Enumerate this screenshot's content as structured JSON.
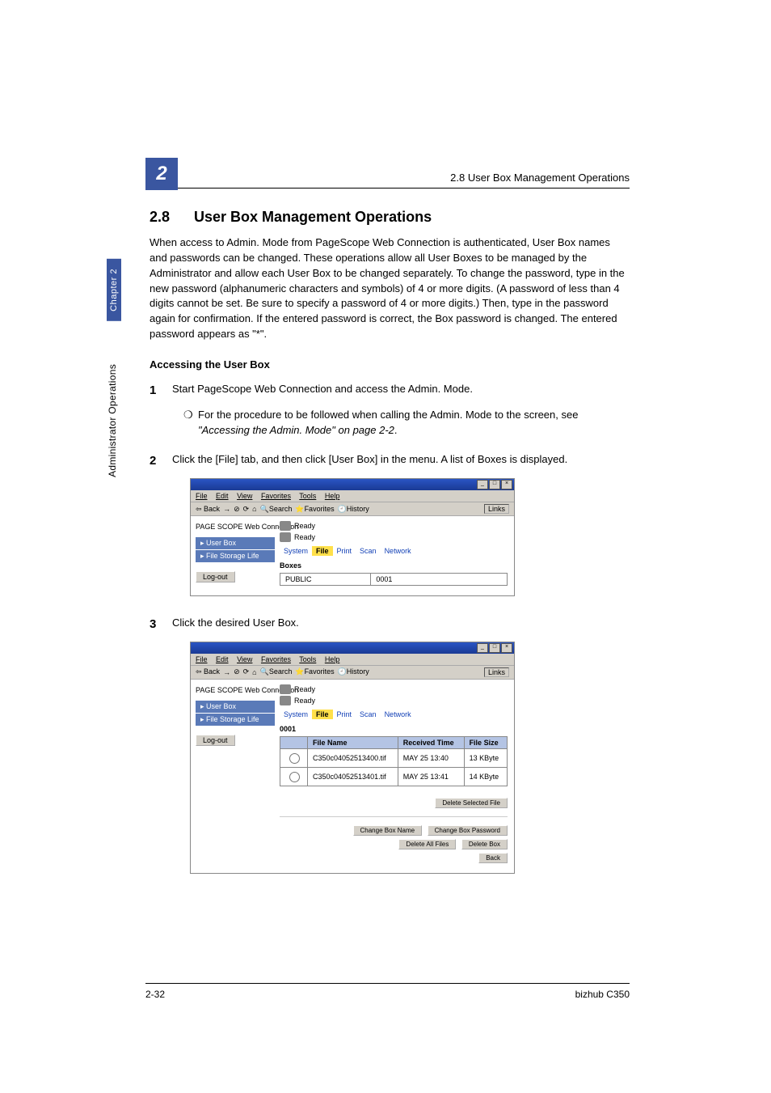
{
  "header": {
    "title": "2.8 User Box Management Operations",
    "chapter_badge": "2"
  },
  "side": {
    "tab": "Chapter 2",
    "label": "Administrator Operations"
  },
  "section": {
    "number": "2.8",
    "title": "User Box Management Operations",
    "body": "When access to Admin. Mode from PageScope Web Connection is authenticated, User Box names and passwords can be changed. These operations allow all User Boxes to be managed by the Administrator and allow each User Box to be changed separately. To change the password, type in the new password (alphanumeric characters and symbols) of 4 or more digits. (A password of less than 4 digits cannot be set. Be sure to specify a password of 4 or more digits.) Then, type in the password again for confirmation. If the entered password is correct, the Box password is changed. The entered password appears as \"*\"."
  },
  "subheading": "Accessing the User Box",
  "steps": {
    "s1": {
      "num": "1",
      "text": "Start PageScope Web Connection and access the Admin. Mode."
    },
    "note1": {
      "bullet": "❍",
      "text_prefix": "For the procedure to be followed when calling the Admin. Mode to the screen, see ",
      "text_italic": "\"Accessing the Admin. Mode\" on page 2-2",
      "text_suffix": "."
    },
    "s2": {
      "num": "2",
      "text": "Click the [File] tab, and then click [User Box] in the menu. A list of Boxes is displayed."
    },
    "s3": {
      "num": "3",
      "text": "Click the desired User Box."
    }
  },
  "screenshot1": {
    "menus": {
      "file": "File",
      "edit": "Edit",
      "view": "View",
      "favorites": "Favorites",
      "tools": "Tools",
      "help": "Help"
    },
    "toolbar": {
      "back": "Back",
      "search": "Search",
      "favorites": "Favorites",
      "history": "History",
      "links": "Links"
    },
    "logo": "PAGE SCOPE Web Connection",
    "nav": {
      "userbox": "User Box",
      "filestorage": "File Storage Life"
    },
    "logout": "Log-out",
    "status": {
      "ready1": "Ready",
      "ready2": "Ready"
    },
    "tabs": {
      "system": "System",
      "file": "File",
      "print": "Print",
      "scan": "Scan",
      "network": "Network"
    },
    "section_label": "Boxes",
    "table": {
      "name": "PUBLIC",
      "num": "0001"
    }
  },
  "screenshot2": {
    "menus": {
      "file": "File",
      "edit": "Edit",
      "view": "View",
      "favorites": "Favorites",
      "tools": "Tools",
      "help": "Help"
    },
    "toolbar": {
      "back": "Back",
      "search": "Search",
      "favorites": "Favorites",
      "history": "History",
      "links": "Links"
    },
    "logo": "PAGE SCOPE Web Connection",
    "nav": {
      "userbox": "User Box",
      "filestorage": "File Storage Life"
    },
    "logout": "Log-out",
    "status": {
      "ready1": "Ready",
      "ready2": "Ready"
    },
    "tabs": {
      "system": "System",
      "file": "File",
      "print": "Print",
      "scan": "Scan",
      "network": "Network"
    },
    "box_label": "0001",
    "headers": {
      "filename": "File Name",
      "received": "Received Time",
      "filesize": "File Size"
    },
    "rows": [
      {
        "name": "C350c04052513400.tif",
        "time": "MAY 25 13:40",
        "size": "13 KByte"
      },
      {
        "name": "C350c04052513401.tif",
        "time": "MAY 25 13:41",
        "size": "14 KByte"
      }
    ],
    "buttons": {
      "delete_selected": "Delete Selected File",
      "change_name": "Change Box Name",
      "change_pwd": "Change Box Password",
      "delete_all": "Delete All Files",
      "delete_box": "Delete Box",
      "back": "Back"
    }
  },
  "footer": {
    "page": "2-32",
    "model": "bizhub C350"
  }
}
